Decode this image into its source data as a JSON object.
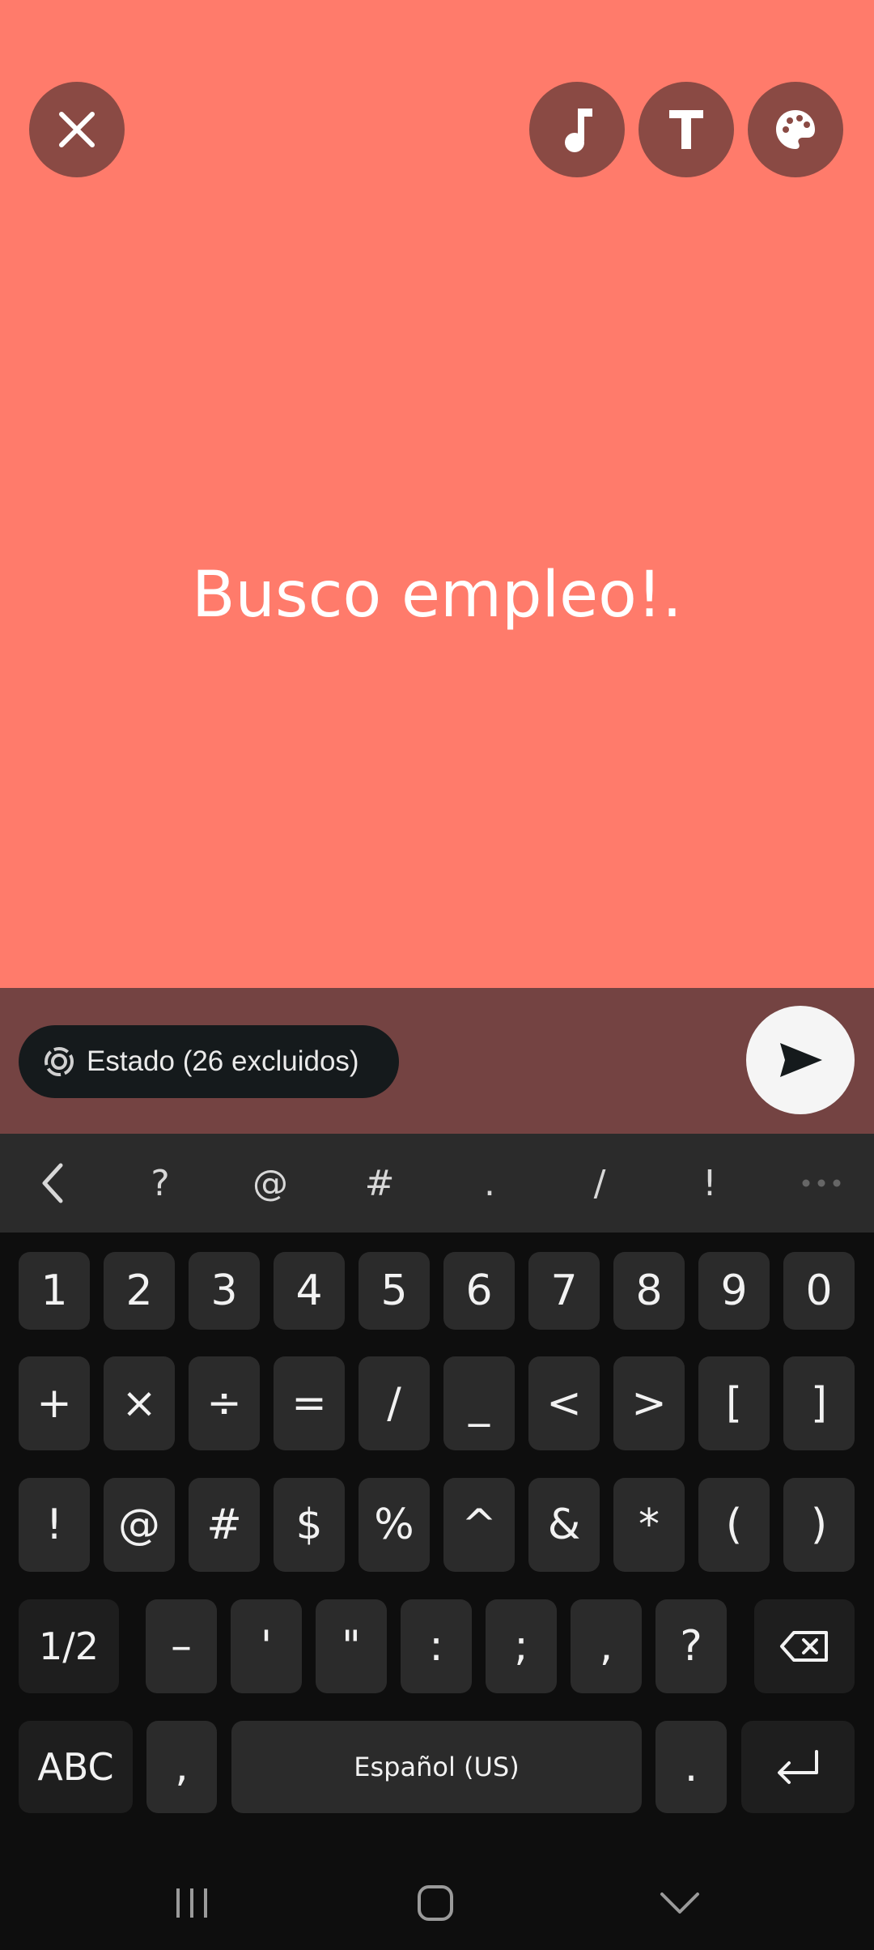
{
  "status": {
    "text": "Busco empleo!."
  },
  "compose": {
    "audience_label": "Estado (26 excluidos)"
  },
  "toolbar": {
    "symbols": [
      "?",
      "@",
      "#",
      ".",
      "/",
      "!"
    ]
  },
  "keyboard": {
    "row1": [
      "1",
      "2",
      "3",
      "4",
      "5",
      "6",
      "7",
      "8",
      "9",
      "0"
    ],
    "row2": [
      "+",
      "×",
      "÷",
      "=",
      "/",
      "_",
      "<",
      ">",
      "[",
      "]"
    ],
    "row3": [
      "!",
      "@",
      "#",
      "$",
      "%",
      "^",
      "&",
      "*",
      "(",
      ")"
    ],
    "row4_page": "1/2",
    "row4": [
      "–",
      "'",
      "\"",
      ":",
      ";",
      ",",
      "?"
    ],
    "abc_label": "ABC",
    "comma": ",",
    "space_label": "Español (US)",
    "period": "."
  },
  "colors": {
    "background": "#ff7b6b",
    "compose_bar": "#744342",
    "keyboard": "#0e0e0e"
  }
}
